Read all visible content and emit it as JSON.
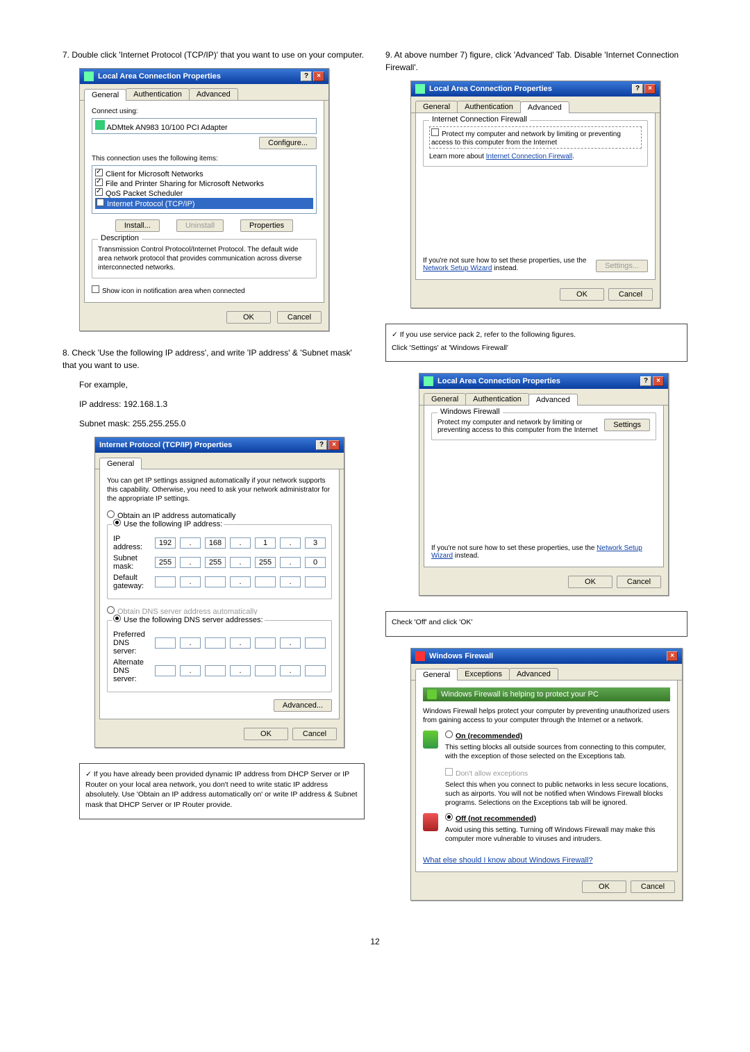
{
  "left": {
    "step7": "7. Double click 'Internet Protocol (TCP/IP)' that you want to use on your computer.",
    "step8": "8. Check 'Use the following IP address', and write 'IP address' & 'Subnet mask' that you want to use.",
    "example_lead": "For example,",
    "example_ip": "IP address: 192.168.1.3",
    "example_mask": "Subnet mask: 255.255.255.0",
    "note1": "✓ If you have already been provided dynamic IP address from DHCP Server or IP Router on your local area network, you don't need to write static IP address absolutely. Use 'Obtain an IP address automatically on' or write IP address & Subnet mask that DHCP Server or IP Router provide."
  },
  "right": {
    "step9": "9. At above number 7) figure, click 'Advanced' Tab. Disable 'Internet Connection Firewall'.",
    "note2a": "✓ If you use service pack 2, refer to the following figures.",
    "note2b": "Click 'Settings' at 'Windows Firewall'",
    "note3": "Check 'Off' and click 'OK'"
  },
  "lacp": {
    "title": "Local Area Connection Properties",
    "tabs": [
      "General",
      "Authentication",
      "Advanced"
    ],
    "connect_using_label": "Connect using:",
    "adapter": "ADMtek AN983 10/100 PCI Adapter",
    "configure": "Configure...",
    "uses_items": "This connection uses the following items:",
    "items": [
      "Client for Microsoft Networks",
      "File and Printer Sharing for Microsoft Networks",
      "QoS Packet Scheduler",
      "Internet Protocol (TCP/IP)"
    ],
    "install": "Install...",
    "uninstall": "Uninstall",
    "properties": "Properties",
    "desc_label": "Description",
    "desc_text": "Transmission Control Protocol/Internet Protocol. The default wide area network protocol that provides communication across diverse interconnected networks.",
    "show_icon": "Show icon in notification area when connected",
    "ok": "OK",
    "cancel": "Cancel"
  },
  "ipp": {
    "title": "Internet Protocol (TCP/IP) Properties",
    "tab": "General",
    "blurb": "You can get IP settings assigned automatically if your network supports this capability. Otherwise, you need to ask your network administrator for the appropriate IP settings.",
    "auto": "Obtain an IP address automatically",
    "use": "Use the following IP address:",
    "ip_label": "IP address:",
    "mask_label": "Subnet mask:",
    "gw_label": "Default gateway:",
    "dns_auto": "Obtain DNS server address automatically",
    "dns_use": "Use the following DNS server addresses:",
    "pref": "Preferred DNS server:",
    "alt": "Alternate DNS server:",
    "advanced": "Advanced...",
    "ok": "OK",
    "cancel": "Cancel",
    "ip_vals": [
      "192",
      "168",
      "1",
      "3"
    ],
    "mask_vals": [
      "255",
      "255",
      "255",
      "0"
    ]
  },
  "icf": {
    "group": "Internet Connection Firewall",
    "chk": "Protect my computer and network by limiting or preventing access to this computer from the Internet",
    "learn": "Learn more about",
    "learn_link": "Internet Connection Firewall",
    "hint": "If you're not sure how to set these properties, use the",
    "hint_link": "Network Setup Wizard",
    "hint_tail": "instead.",
    "settings": "Settings...",
    "ok": "OK",
    "cancel": "Cancel"
  },
  "wfw_lacp": {
    "group": "Windows Firewall",
    "blurb": "Protect my computer and network by limiting or preventing access to this computer from the Internet",
    "settings": "Settings",
    "hint": "If you're not sure how to set these properties, use the",
    "hint_link": "Network Setup Wizard",
    "hint_tail": "instead.",
    "ok": "OK",
    "cancel": "Cancel"
  },
  "wfw": {
    "title": "Windows Firewall",
    "tabs": [
      "General",
      "Exceptions",
      "Advanced"
    ],
    "banner": "Windows Firewall is helping to protect your PC",
    "intro": "Windows Firewall helps protect your computer by preventing unauthorized users from gaining access to your computer through the Internet or a network.",
    "on_label": "On (recommended)",
    "on_desc": "This setting blocks all outside sources from connecting to this computer, with the exception of those selected on the Exceptions tab.",
    "dont_label": "Don't allow exceptions",
    "dont_desc": "Select this when you connect to public networks in less secure locations, such as airports. You will not be notified when Windows Firewall blocks programs. Selections on the Exceptions tab will be ignored.",
    "off_label": "Off (not recommended)",
    "off_desc": "Avoid using this setting. Turning off Windows Firewall may make this computer more vulnerable to viruses and intruders.",
    "more": "What else should I know about Windows Firewall?",
    "ok": "OK",
    "cancel": "Cancel"
  },
  "page_num": "12",
  "chart_data": {
    "type": "table",
    "title": "TCP/IP example settings",
    "rows": [
      {
        "field": "IP address",
        "value": "192.168.1.3"
      },
      {
        "field": "Subnet mask",
        "value": "255.255.255.0"
      }
    ]
  }
}
